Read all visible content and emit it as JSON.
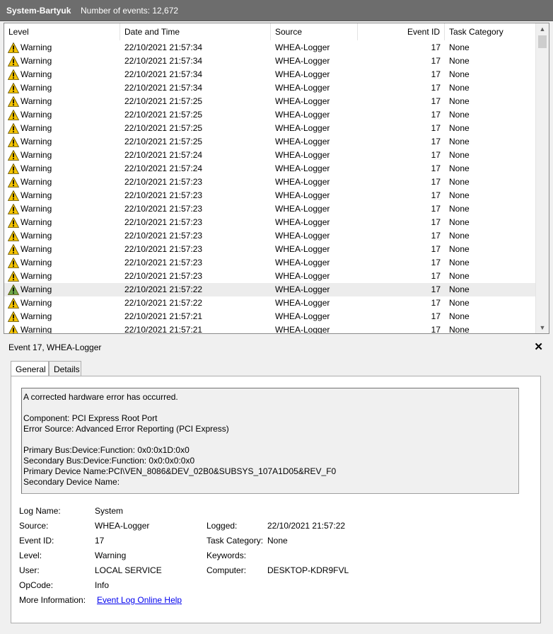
{
  "title": {
    "log_name": "System-Bartyuk",
    "event_count": "Number of events: 12,672"
  },
  "columns": {
    "level": "Level",
    "datetime": "Date and Time",
    "source": "Source",
    "event_id": "Event ID",
    "task_category": "Task Category"
  },
  "events": [
    {
      "level": "Warning",
      "datetime": "22/10/2021 21:57:34",
      "source": "WHEA-Logger",
      "event_id": "17",
      "category": "None"
    },
    {
      "level": "Warning",
      "datetime": "22/10/2021 21:57:34",
      "source": "WHEA-Logger",
      "event_id": "17",
      "category": "None"
    },
    {
      "level": "Warning",
      "datetime": "22/10/2021 21:57:34",
      "source": "WHEA-Logger",
      "event_id": "17",
      "category": "None"
    },
    {
      "level": "Warning",
      "datetime": "22/10/2021 21:57:34",
      "source": "WHEA-Logger",
      "event_id": "17",
      "category": "None"
    },
    {
      "level": "Warning",
      "datetime": "22/10/2021 21:57:25",
      "source": "WHEA-Logger",
      "event_id": "17",
      "category": "None"
    },
    {
      "level": "Warning",
      "datetime": "22/10/2021 21:57:25",
      "source": "WHEA-Logger",
      "event_id": "17",
      "category": "None"
    },
    {
      "level": "Warning",
      "datetime": "22/10/2021 21:57:25",
      "source": "WHEA-Logger",
      "event_id": "17",
      "category": "None"
    },
    {
      "level": "Warning",
      "datetime": "22/10/2021 21:57:25",
      "source": "WHEA-Logger",
      "event_id": "17",
      "category": "None"
    },
    {
      "level": "Warning",
      "datetime": "22/10/2021 21:57:24",
      "source": "WHEA-Logger",
      "event_id": "17",
      "category": "None"
    },
    {
      "level": "Warning",
      "datetime": "22/10/2021 21:57:24",
      "source": "WHEA-Logger",
      "event_id": "17",
      "category": "None"
    },
    {
      "level": "Warning",
      "datetime": "22/10/2021 21:57:23",
      "source": "WHEA-Logger",
      "event_id": "17",
      "category": "None"
    },
    {
      "level": "Warning",
      "datetime": "22/10/2021 21:57:23",
      "source": "WHEA-Logger",
      "event_id": "17",
      "category": "None"
    },
    {
      "level": "Warning",
      "datetime": "22/10/2021 21:57:23",
      "source": "WHEA-Logger",
      "event_id": "17",
      "category": "None"
    },
    {
      "level": "Warning",
      "datetime": "22/10/2021 21:57:23",
      "source": "WHEA-Logger",
      "event_id": "17",
      "category": "None"
    },
    {
      "level": "Warning",
      "datetime": "22/10/2021 21:57:23",
      "source": "WHEA-Logger",
      "event_id": "17",
      "category": "None"
    },
    {
      "level": "Warning",
      "datetime": "22/10/2021 21:57:23",
      "source": "WHEA-Logger",
      "event_id": "17",
      "category": "None"
    },
    {
      "level": "Warning",
      "datetime": "22/10/2021 21:57:23",
      "source": "WHEA-Logger",
      "event_id": "17",
      "category": "None"
    },
    {
      "level": "Warning",
      "datetime": "22/10/2021 21:57:23",
      "source": "WHEA-Logger",
      "event_id": "17",
      "category": "None"
    },
    {
      "level": "Warning",
      "datetime": "22/10/2021 21:57:22",
      "source": "WHEA-Logger",
      "event_id": "17",
      "category": "None",
      "selected": true
    },
    {
      "level": "Warning",
      "datetime": "22/10/2021 21:57:22",
      "source": "WHEA-Logger",
      "event_id": "17",
      "category": "None"
    },
    {
      "level": "Warning",
      "datetime": "22/10/2021 21:57:21",
      "source": "WHEA-Logger",
      "event_id": "17",
      "category": "None"
    },
    {
      "level": "Warning",
      "datetime": "22/10/2021 21:57:21",
      "source": "WHEA-Logger",
      "event_id": "17",
      "category": "None"
    }
  ],
  "detail": {
    "header": "Event 17, WHEA-Logger",
    "close_icon": "close-icon",
    "tabs": {
      "general": "General",
      "details": "Details"
    },
    "description": [
      "A corrected hardware error has occurred.",
      "",
      "Component: PCI Express Root Port",
      "Error Source: Advanced Error Reporting (PCI Express)",
      "",
      "Primary Bus:Device:Function: 0x0:0x1D:0x0",
      "Secondary Bus:Device:Function: 0x0:0x0:0x0",
      "Primary Device Name:PCI\\VEN_8086&DEV_02B0&SUBSYS_107A1D05&REV_F0",
      "Secondary Device Name:"
    ],
    "props": {
      "log_name_label": "Log Name:",
      "log_name": "System",
      "source_label": "Source:",
      "source": "WHEA-Logger",
      "logged_label": "Logged:",
      "logged": "22/10/2021 21:57:22",
      "event_id_label": "Event ID:",
      "event_id": "17",
      "task_category_label": "Task Category:",
      "task_category": "None",
      "level_label": "Level:",
      "level": "Warning",
      "keywords_label": "Keywords:",
      "keywords": "",
      "user_label": "User:",
      "user": "LOCAL SERVICE",
      "computer_label": "Computer:",
      "computer": "DESKTOP-KDR9FVL",
      "opcode_label": "OpCode:",
      "opcode": "Info",
      "more_info_label": "More Information:",
      "more_info_link": "Event Log Online Help"
    }
  },
  "colors": {
    "warning_yellow": "#f5c400",
    "warning_selected_green": "#6fa84a",
    "titlebar": "#6d6d6d",
    "link": "#0000ee"
  }
}
